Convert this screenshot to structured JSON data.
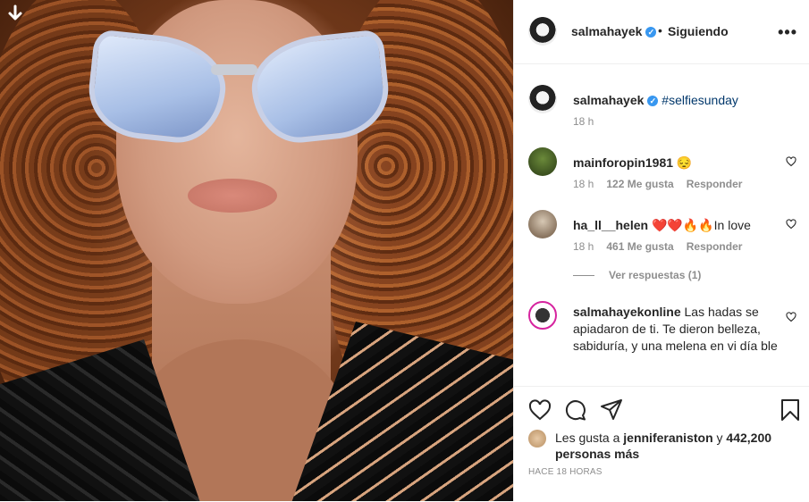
{
  "post": {
    "author": "salmahayek",
    "follow_status": "Siguiendo",
    "dot": "•",
    "more_label": "•••"
  },
  "caption": {
    "author": "salmahayek",
    "text": "#selfiesunday",
    "time": "18 h"
  },
  "comments": [
    {
      "user": "mainforopin1981",
      "text": "😔",
      "time": "18 h",
      "likes": "122 Me gusta",
      "reply": "Responder"
    },
    {
      "user": "ha_ll__helen",
      "text": "❤️❤️🔥🔥In love",
      "time": "18 h",
      "likes": "461 Me gusta",
      "reply": "Responder"
    },
    {
      "user": "salmahayekonline",
      "text": "Las hadas se apiadaron de ti. Te dieron belleza, sabiduría, y una melena en vi día ble"
    }
  ],
  "view_replies": "Ver respuestas (1)",
  "likes": {
    "prefix": "Les gusta a",
    "user": "jenniferaniston",
    "connector": "y",
    "count": "442,200 personas más"
  },
  "posted_ago": "HACE 18 HORAS",
  "icons": [
    "download-arrow-icon",
    "verified-badge-icon",
    "more-options-icon",
    "heart-icon",
    "comment-icon",
    "share-icon",
    "bookmark-icon"
  ],
  "colors": {
    "verified": "#3897f0",
    "hashtag": "#00376b",
    "muted": "#8e8e8e",
    "text": "#262626"
  }
}
